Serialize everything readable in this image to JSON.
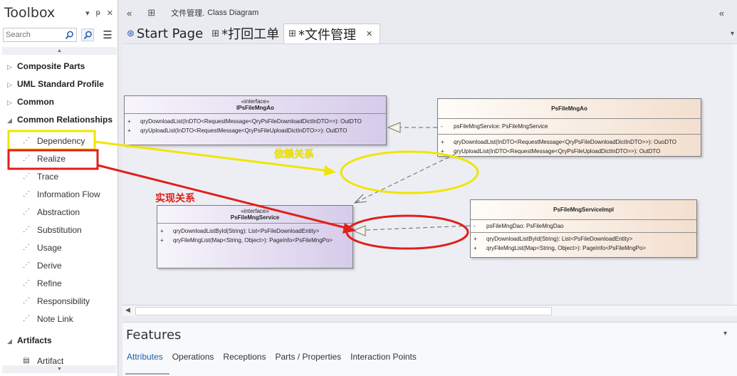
{
  "toolbox": {
    "title": "Toolbox",
    "search_placeholder": "Search",
    "groups": [
      {
        "label": "Composite Parts"
      },
      {
        "label": "UML Standard Profile"
      },
      {
        "label": "Common"
      },
      {
        "label": "Common Relationships"
      },
      {
        "label": "Artifacts"
      }
    ],
    "items": [
      {
        "label": "Dependency"
      },
      {
        "label": "Realize"
      },
      {
        "label": "Trace"
      },
      {
        "label": "Information Flow"
      },
      {
        "label": "Abstraction"
      },
      {
        "label": "Substitution"
      },
      {
        "label": "Usage"
      },
      {
        "label": "Derive"
      },
      {
        "label": "Refine"
      },
      {
        "label": "Responsibility"
      },
      {
        "label": "Note Link"
      },
      {
        "label": "Artifact"
      }
    ]
  },
  "topbar": {
    "breadcrumb": "文件管理.",
    "diagram_type": "Class Diagram"
  },
  "tabs": [
    {
      "label": "Start Page"
    },
    {
      "label": "*打回工单"
    },
    {
      "label": "*文件管理"
    }
  ],
  "diagram": {
    "classes": [
      {
        "stereotype": "«interface»",
        "name": "IPsFileMngAo",
        "attributes": [],
        "operations": [
          {
            "vis": "+",
            "text": "qryDownloadList(InDTO<RequestMessage<QryPsFileDownloadDictInDTO>>): OutDTO"
          },
          {
            "vis": "+",
            "text": "qryUploadList(InDTO<RequestMessage<QryPsFileUploadDictInDTO>>): OutDTO"
          }
        ]
      },
      {
        "stereotype": "",
        "name": "PsFileMngAo",
        "attributes": [
          {
            "vis": "-",
            "text": "psFileMngService: PsFileMngService"
          }
        ],
        "operations": [
          {
            "vis": "+",
            "text": "qryDownloadList(InDTO<RequestMessage<QryPsFileDownloadDictInDTO>>): OuoDTO"
          },
          {
            "vis": "+",
            "text": "qryUploadList(InDTO<RequestMessage<QryPsFileUploadDictInDTO>>): OutDTO"
          }
        ]
      },
      {
        "stereotype": "«interface»",
        "name": "PsFileMngService",
        "attributes": [],
        "operations": [
          {
            "vis": "+",
            "text": "qryDownloadListById(String): List<PsFileDownloadEntity>"
          },
          {
            "vis": "+",
            "text": "qryFileMngList(Map<String, Object>): PageInfo<PsFileMngPo>"
          }
        ]
      },
      {
        "stereotype": "",
        "name": "PsFileMngServiceImpl",
        "attributes": [
          {
            "vis": "-",
            "text": "psFileMngDao: PsFileMngDao"
          }
        ],
        "operations": [
          {
            "vis": "+",
            "text": "qryDownloadListById(String): List<PsFileDownloadEntity>"
          },
          {
            "vis": "+",
            "text": "qryFileMngList(Map<String, Object>): PageInfo<PsFileMngPo>"
          }
        ]
      }
    ]
  },
  "annotations": {
    "dependency": "依赖关系",
    "realize": "实现关系"
  },
  "features": {
    "title": "Features",
    "tabs": [
      "Attributes",
      "Operations",
      "Receptions",
      "Parts / Properties",
      "Interaction Points"
    ]
  },
  "colors": {
    "annotation_yellow": "#f0e500",
    "annotation_red": "#e0201a",
    "interface_fill": "#d6cbea",
    "class_fill": "#f3dfcf"
  }
}
